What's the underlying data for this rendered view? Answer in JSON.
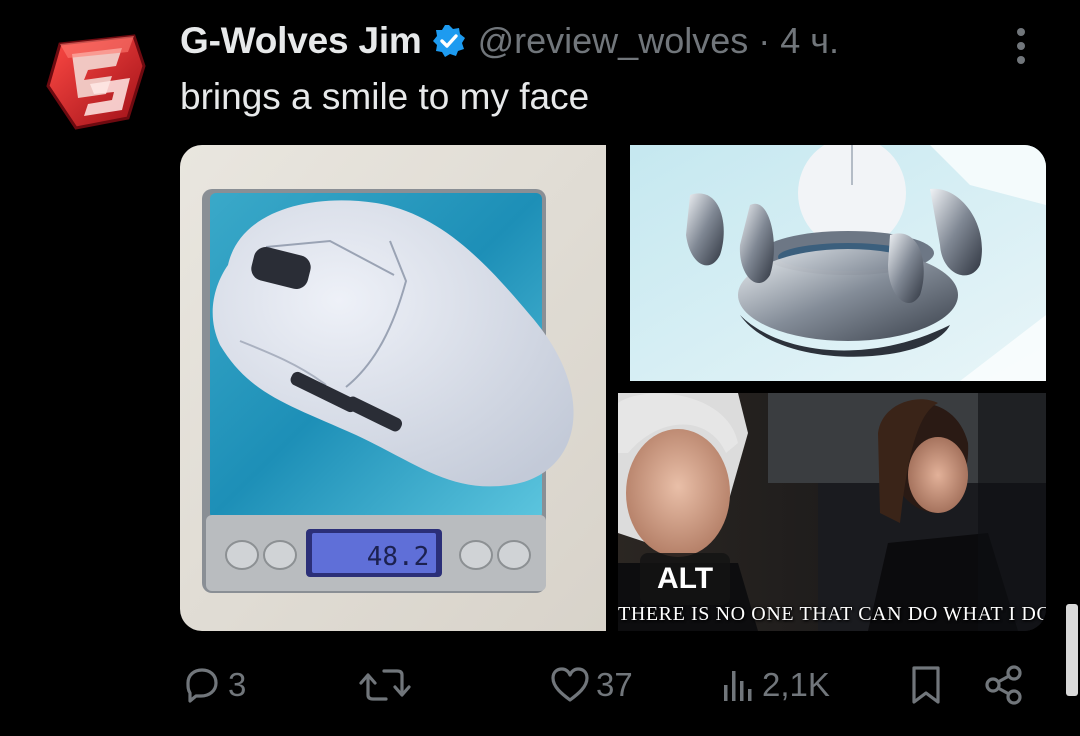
{
  "author": {
    "display_name": "G-Wolves Jim",
    "handle": "@review_wolves",
    "separator": "·",
    "time": "4 ч.",
    "verified_icon": "verified-badge-icon",
    "avatar_icon": "g-wolves-logo"
  },
  "tweet": {
    "text": "brings a smile to my face"
  },
  "media": {
    "scale_reading": "48.2",
    "alt_badge": "ALT",
    "caption": "THERE IS NO ONE THAT CAN DO WHAT I DO"
  },
  "actions": {
    "reply_count": "3",
    "retweet_count": "",
    "like_count": "37",
    "views_count": "2,1K"
  },
  "colors": {
    "background": "#000000",
    "text_primary": "#e7e9ea",
    "text_secondary": "#71767b",
    "verified_blue": "#1d9bf0",
    "brand_red": "#c8202a"
  }
}
